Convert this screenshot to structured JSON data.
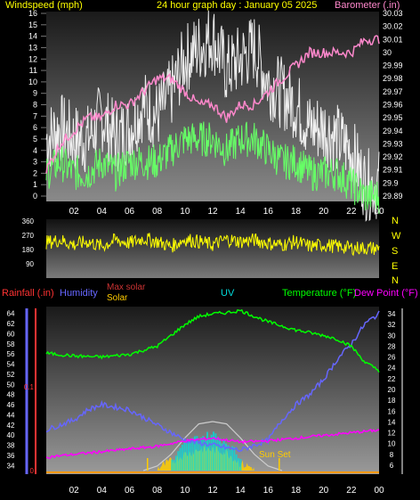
{
  "header": {
    "wind_label": "Windspeed (mph)",
    "title": "24 hour graph day : January 05 2025",
    "baro_label": "Barometer (.in)"
  },
  "panel2": {
    "compass": [
      "N",
      "W",
      "S",
      "E",
      "N"
    ]
  },
  "panel3": {
    "rain_label": "Rainfall (.in)",
    "humidity_label": "Humidity",
    "maxsolar_label": "Max solar",
    "solar_label": "Solar",
    "uv_label": "UV",
    "temp_label": "Temperature (°F)",
    "dew_label": "Dew Point (°F)",
    "sunset_label": "Sun Set"
  },
  "colors": {
    "wind_gust": "#ffffff",
    "wind_avg": "#66ff66",
    "barometer": "#ff88cc",
    "direction": "#ffff00",
    "temperature": "#00ff00",
    "dewpoint": "#ff00ff",
    "humidity": "#6666ff",
    "rain": "#ff3333",
    "solar": "#ffcc00",
    "uv": "#00dddd",
    "maxsolar": "#cccccc"
  },
  "chart_data": [
    {
      "type": "line",
      "name": "wind-baro",
      "x_ticks": [
        "02",
        "04",
        "06",
        "08",
        "10",
        "12",
        "14",
        "16",
        "18",
        "20",
        "22",
        "00"
      ],
      "y_left_ticks": [
        0,
        1,
        2,
        3,
        4,
        5,
        6,
        7,
        8,
        9,
        10,
        11,
        12,
        13,
        14,
        15,
        16
      ],
      "y_right_ticks": [
        "29.89",
        "29.9",
        "29.91",
        "29.92",
        "29.93",
        "29.94",
        "29.95",
        "29.96",
        "29.97",
        "29.98",
        "29.99",
        "30",
        "30.01",
        "30.02",
        "30.03"
      ],
      "ylim_left": [
        0,
        16
      ],
      "ylim_right": [
        29.89,
        30.03
      ],
      "series": [
        {
          "name": "Windspeed gust",
          "x": [
            0,
            1,
            2,
            3,
            4,
            5,
            6,
            7,
            8,
            9,
            10,
            11,
            12,
            13,
            14,
            15,
            16,
            17,
            18,
            19,
            20,
            21,
            22,
            23,
            24
          ],
          "values": [
            5,
            6,
            5,
            5,
            7,
            5,
            6,
            8,
            7,
            9,
            12,
            13,
            14,
            11,
            12,
            13,
            10,
            9,
            8,
            6,
            6,
            5,
            4,
            1,
            1
          ]
        },
        {
          "name": "Windspeed avg",
          "x": [
            0,
            1,
            2,
            3,
            4,
            5,
            6,
            7,
            8,
            9,
            10,
            11,
            12,
            13,
            14,
            15,
            16,
            17,
            18,
            19,
            20,
            21,
            22,
            23,
            24
          ],
          "values": [
            2,
            3,
            2,
            2,
            3,
            2,
            3,
            3,
            3,
            4,
            5,
            5,
            5,
            4,
            5,
            5,
            4,
            3,
            3,
            2,
            2,
            2,
            1,
            0,
            0
          ]
        },
        {
          "name": "Barometer",
          "x": [
            0,
            1,
            2,
            3,
            4,
            5,
            6,
            7,
            8,
            9,
            10,
            11,
            12,
            13,
            14,
            15,
            16,
            17,
            18,
            19,
            20,
            21,
            22,
            23,
            24
          ],
          "values": [
            29.91,
            29.93,
            29.94,
            29.95,
            29.95,
            29.96,
            29.96,
            29.97,
            29.98,
            29.98,
            29.97,
            29.96,
            29.96,
            29.95,
            29.96,
            29.96,
            29.97,
            29.98,
            29.99,
            30.0,
            30.0,
            30.0,
            30.0,
            30.01,
            30.01
          ]
        }
      ]
    },
    {
      "type": "line",
      "name": "wind-direction",
      "x_ticks": [
        "02",
        "04",
        "06",
        "08",
        "10",
        "12",
        "14",
        "16",
        "18",
        "20",
        "22",
        "00"
      ],
      "y_ticks": [
        90,
        180,
        270,
        360
      ],
      "ylim": [
        0,
        360
      ],
      "series": [
        {
          "name": "Wind direction",
          "x": [
            0,
            1,
            2,
            3,
            4,
            5,
            6,
            7,
            8,
            9,
            10,
            11,
            12,
            13,
            14,
            15,
            16,
            17,
            18,
            19,
            20,
            21,
            22,
            23,
            24
          ],
          "values": [
            225,
            240,
            210,
            230,
            200,
            240,
            220,
            250,
            230,
            200,
            245,
            230,
            210,
            245,
            230,
            240,
            220,
            210,
            230,
            200,
            210,
            200,
            190,
            190,
            185
          ]
        }
      ]
    },
    {
      "type": "line",
      "name": "temp-humidity-solar",
      "x_ticks": [
        "02",
        "04",
        "06",
        "08",
        "10",
        "12",
        "14",
        "16",
        "18",
        "20",
        "22",
        "00"
      ],
      "y_humidity_ticks": [
        34,
        36,
        38,
        40,
        42,
        44,
        46,
        48,
        50,
        52,
        54,
        56,
        58,
        60,
        62,
        64
      ],
      "y_rain_ticks": [
        "0.1",
        "0"
      ],
      "y_temp_ticks": [
        6,
        8,
        10,
        12,
        14,
        16,
        18,
        20,
        22,
        24,
        26,
        28,
        30,
        32,
        34
      ],
      "ylim_humidity": [
        33,
        65
      ],
      "ylim_temp": [
        5,
        35
      ],
      "series": [
        {
          "name": "Temperature",
          "x": [
            0,
            2,
            4,
            6,
            8,
            10,
            11,
            12,
            13,
            14,
            16,
            18,
            20,
            21,
            22,
            23,
            24
          ],
          "values": [
            26.7,
            26.2,
            26.0,
            26.5,
            28.0,
            32.0,
            33.5,
            34.0,
            34.2,
            34.6,
            32.5,
            31.0,
            30.0,
            29.3,
            28.0,
            25.0,
            23.5
          ]
        },
        {
          "name": "Dew Point",
          "x": [
            0,
            2,
            4,
            6,
            8,
            10,
            12,
            14,
            16,
            18,
            20,
            22,
            24
          ],
          "values": [
            7.5,
            8.0,
            8.5,
            9.0,
            9.5,
            10.5,
            11.0,
            10.3,
            10.5,
            11.0,
            11.5,
            12.0,
            12.5
          ]
        },
        {
          "name": "Humidity",
          "x": [
            0,
            2,
            3,
            4,
            6,
            8,
            10,
            12,
            14,
            16,
            17,
            18,
            19,
            20,
            21,
            22,
            23,
            24
          ],
          "values": [
            41,
            43,
            45,
            46,
            45,
            42,
            39,
            38,
            37,
            39,
            43,
            46,
            48,
            51,
            55,
            58,
            62,
            64
          ]
        },
        {
          "name": "Max solar",
          "x": [
            7,
            8,
            9,
            10,
            11,
            12,
            13,
            14,
            15,
            16,
            17
          ],
          "values": [
            0,
            2,
            7,
            14,
            20,
            21,
            20,
            14,
            7,
            2,
            0
          ]
        },
        {
          "name": "Solar",
          "x": [
            8,
            9,
            10,
            11,
            12,
            13,
            14,
            15
          ],
          "values": [
            1,
            4,
            7,
            9,
            9,
            8,
            3,
            1
          ]
        },
        {
          "name": "UV",
          "x": [
            9,
            10,
            11,
            12,
            13,
            14
          ],
          "values": [
            3,
            10,
            12,
            13,
            10,
            4
          ]
        }
      ]
    }
  ]
}
